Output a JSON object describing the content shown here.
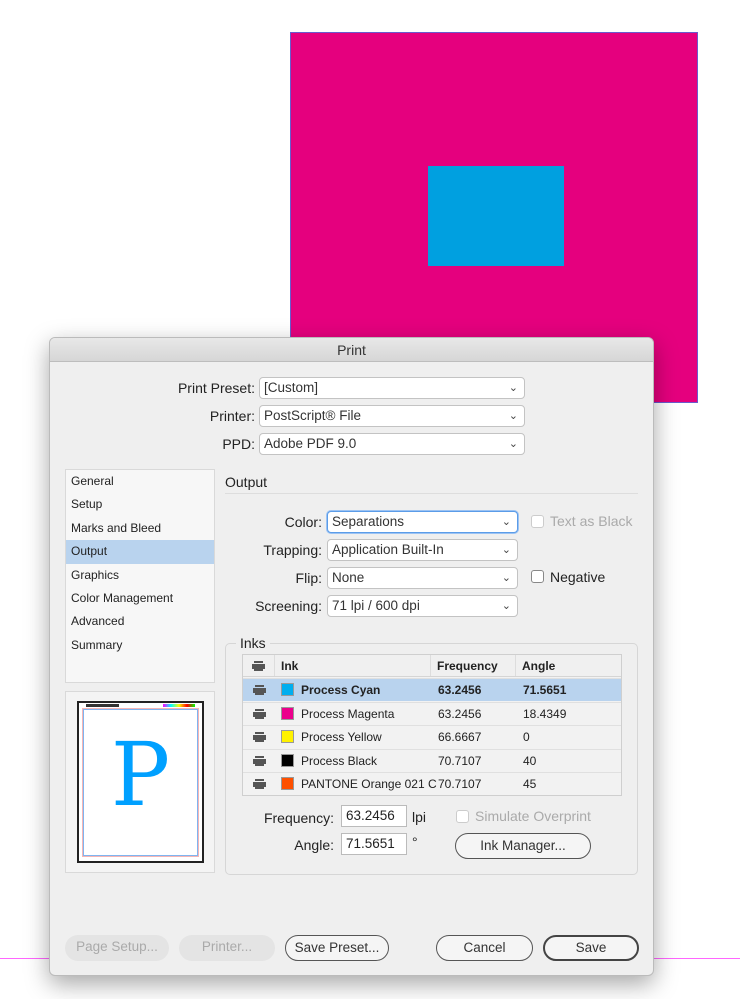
{
  "dialog": {
    "title": "Print",
    "preset_label": "Print Preset:",
    "preset_value": "[Custom]",
    "printer_label": "Printer:",
    "printer_value": "PostScript® File",
    "ppd_label": "PPD:",
    "ppd_value": "Adobe PDF 9.0"
  },
  "sidebar": {
    "items": [
      {
        "label": "General"
      },
      {
        "label": "Setup"
      },
      {
        "label": "Marks and Bleed"
      },
      {
        "label": "Output"
      },
      {
        "label": "Graphics"
      },
      {
        "label": "Color Management"
      },
      {
        "label": "Advanced"
      },
      {
        "label": "Summary"
      }
    ],
    "active": "Output"
  },
  "preview": {
    "letter": "P"
  },
  "output": {
    "title": "Output",
    "color_label": "Color:",
    "color_value": "Separations",
    "text_as_black": "Text as Black",
    "trapping_label": "Trapping:",
    "trapping_value": "Application Built-In",
    "flip_label": "Flip:",
    "flip_value": "None",
    "negative": "Negative",
    "screening_label": "Screening:",
    "screening_value": "71 lpi / 600 dpi"
  },
  "inks": {
    "title": "Inks",
    "headers": {
      "ink": "Ink",
      "frequency": "Frequency",
      "angle": "Angle"
    },
    "rows": [
      {
        "name": "Process Cyan",
        "color": "#00AEEF",
        "frequency": "63.2456",
        "angle": "71.5651"
      },
      {
        "name": "Process Magenta",
        "color": "#EC008C",
        "frequency": "63.2456",
        "angle": "18.4349"
      },
      {
        "name": "Process Yellow",
        "color": "#FFF200",
        "frequency": "66.6667",
        "angle": "0"
      },
      {
        "name": "Process Black",
        "color": "#000000",
        "frequency": "70.7107",
        "angle": "40"
      },
      {
        "name": "PANTONE Orange 021 C",
        "color": "#FE5000",
        "frequency": "70.7107",
        "angle": "45"
      }
    ],
    "frequency_label": "Frequency:",
    "frequency_value": "63.2456",
    "frequency_unit": "lpi",
    "angle_label": "Angle:",
    "angle_value": "71.5651",
    "angle_unit": "°",
    "simulate_overprint": "Simulate Overprint",
    "ink_manager": "Ink Manager..."
  },
  "buttons": {
    "page_setup": "Page Setup...",
    "printer": "Printer...",
    "save_preset": "Save Preset...",
    "cancel": "Cancel",
    "save": "Save"
  }
}
